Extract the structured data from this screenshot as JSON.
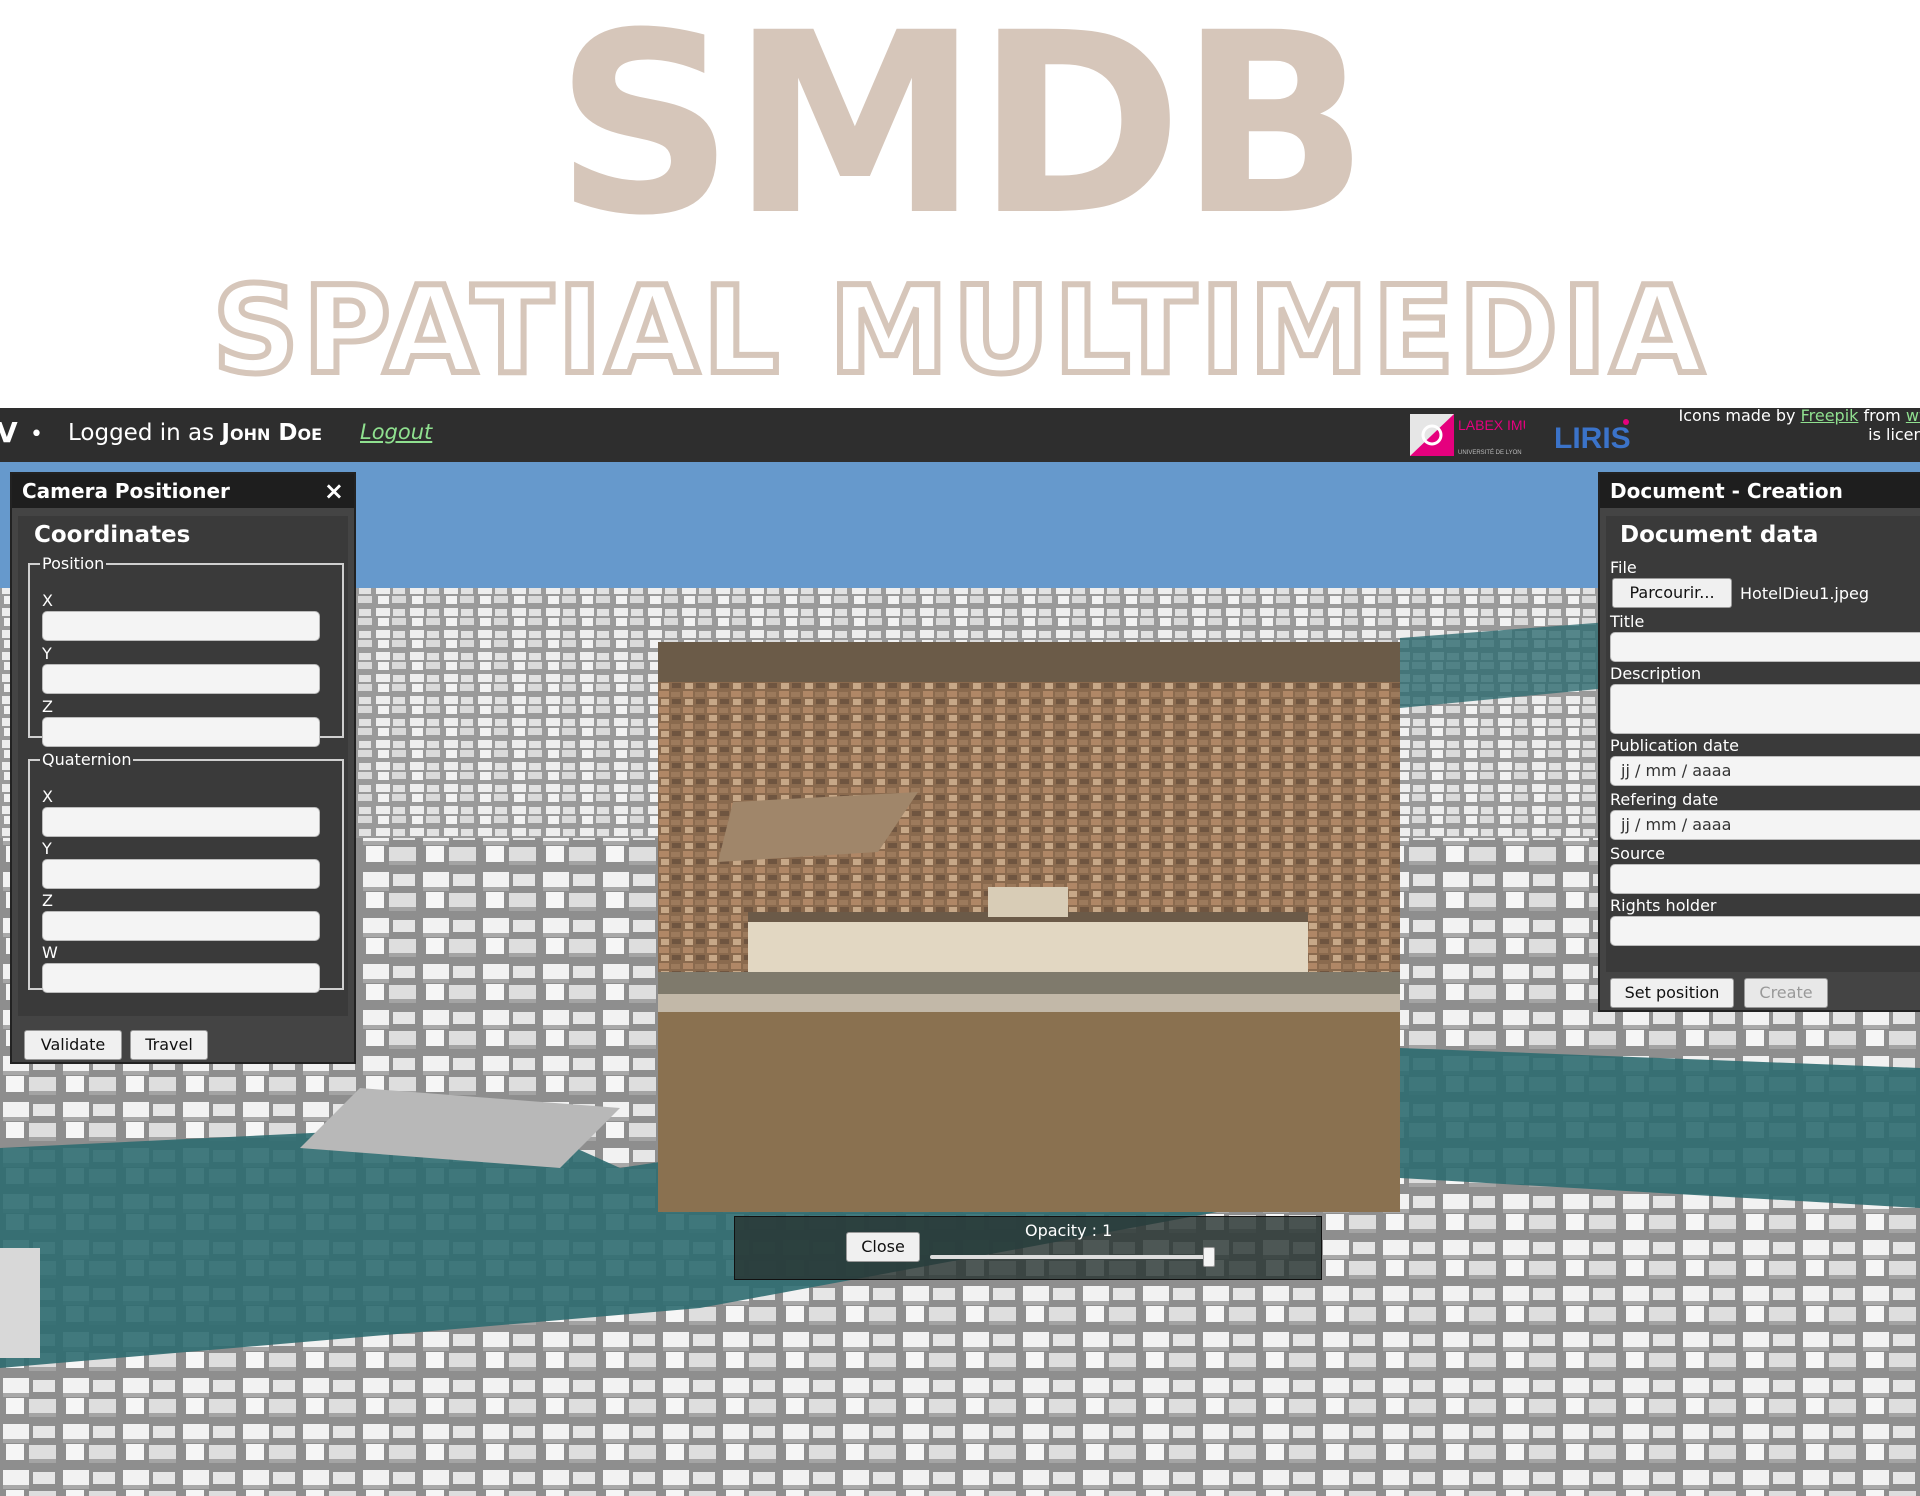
{
  "hero": {
    "title": "SMDB",
    "subtitle": "SPATIAL MULTIMEDIA"
  },
  "topbar": {
    "brand_glyph": "V",
    "separator": "•",
    "login_prefix": "Logged in as ",
    "user_name": "John Doe",
    "logout_label": "Logout",
    "credits_line1_a": "Icons made by ",
    "credits_link1": "Freepik",
    "credits_line1_b": " from ",
    "credits_link2": "ww",
    "credits_line2": "is licens",
    "labex_text": "LABEX IMU",
    "labex_sub": "UNIVERSITÉ DE LYON",
    "liris_text": "LIRIS"
  },
  "camera_panel": {
    "title": "Camera Positioner",
    "close_glyph": "×",
    "section": "Coordinates",
    "position_legend": "Position",
    "position_fields": [
      {
        "label": "X",
        "value": ""
      },
      {
        "label": "Y",
        "value": ""
      },
      {
        "label": "Z",
        "value": ""
      }
    ],
    "quaternion_legend": "Quaternion",
    "quaternion_fields": [
      {
        "label": "X",
        "value": ""
      },
      {
        "label": "Y",
        "value": ""
      },
      {
        "label": "Z",
        "value": ""
      },
      {
        "label": "W",
        "value": ""
      }
    ],
    "validate_label": "Validate",
    "travel_label": "Travel"
  },
  "document_panel": {
    "title": "Document - Creation",
    "section": "Document data",
    "file_label": "File",
    "browse_label": "Parcourir...",
    "file_name": "HotelDieu1.jpeg",
    "title_label": "Title",
    "description_label": "Description",
    "publication_label": "Publication date",
    "publication_placeholder": "jj / mm / aaaa",
    "refering_label": "Refering date",
    "refering_placeholder": "jj / mm / aaaa",
    "source_label": "Source",
    "rights_label": "Rights holder",
    "set_position_label": "Set position",
    "create_label": "Create"
  },
  "document_view": {
    "close_label": "Close",
    "opacity_text": "Opacity : 1",
    "opacity_value": 1
  },
  "colors": {
    "hero": "#d6c6ba",
    "topbar": "#2e2e2e",
    "panel": "#444444",
    "link": "#8fe08f",
    "sky": "#6699cc",
    "river": "#2e6b70"
  }
}
